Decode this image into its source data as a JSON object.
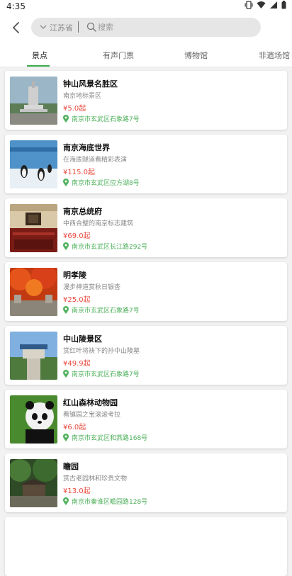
{
  "status": {
    "time": "4:35"
  },
  "search": {
    "province": "江苏省",
    "placeholder": "搜索"
  },
  "tabs": [
    {
      "label": "景点",
      "active": true
    },
    {
      "label": "有声门票",
      "active": false
    },
    {
      "label": "博物馆",
      "active": false
    },
    {
      "label": "非遗场馆",
      "active": false
    }
  ],
  "colors": {
    "accent": "#3cae4c",
    "price": "#e8483c",
    "address": "#4fb15c"
  },
  "items": [
    {
      "title": "钟山风景名胜区",
      "subtitle": "南京地标景区",
      "price": "¥5.0起",
      "address": "南京市玄武区石象路7号",
      "thumb_icon": "monument-photo"
    },
    {
      "title": "南京海底世界",
      "subtitle": "在海底隧道看精彩表演",
      "price": "¥115.0起",
      "address": "南京市玄武区应方湖8号",
      "thumb_icon": "aquarium-penguin-photo"
    },
    {
      "title": "南京总统府",
      "subtitle": "中西合璧的南京标志建筑",
      "price": "¥69.0起",
      "address": "南京市玄武区长江路292号",
      "thumb_icon": "presidential-hall-photo"
    },
    {
      "title": "明孝陵",
      "subtitle": "漫步神道赏秋日银杏",
      "price": "¥25.0起",
      "address": "南京市玄武区石象路7号",
      "thumb_icon": "autumn-trees-photo"
    },
    {
      "title": "中山陵景区",
      "subtitle": "赏红叶将袂下的孙中山陵墓",
      "price": "¥49.9起",
      "address": "南京市玄武区石象路7号",
      "thumb_icon": "mausoleum-photo"
    },
    {
      "title": "红山森林动物园",
      "subtitle": "看镇园之宝滚滚考拉",
      "price": "¥6.0起",
      "address": "南京市玄武区和燕路168号",
      "thumb_icon": "panda-photo"
    },
    {
      "title": "瞻园",
      "subtitle": "赏古老园林和珍贵文物",
      "price": "¥13.0起",
      "address": "南京市秦淮区瞻园路128号",
      "thumb_icon": "garden-photo"
    }
  ]
}
